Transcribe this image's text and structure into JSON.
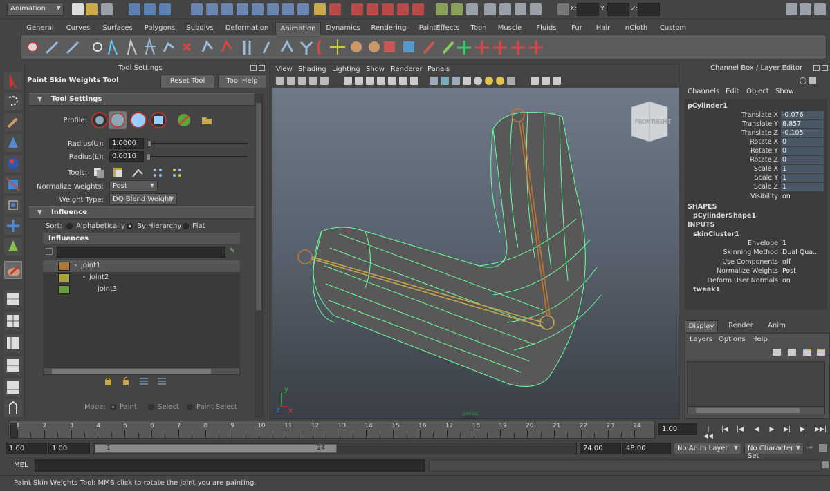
{
  "status_line": {
    "mode": "Animation",
    "x_label": "X:",
    "y_label": "Y:",
    "z_label": "Z:"
  },
  "shelf": {
    "tabs": [
      "General",
      "Curves",
      "Surfaces",
      "Polygons",
      "Subdivs",
      "Deformation",
      "Animation",
      "Dynamics",
      "Rendering",
      "PaintEffects",
      "Toon",
      "Muscle",
      "Fluids",
      "Fur",
      "Hair",
      "nCloth",
      "Custom"
    ],
    "active_tab": "Animation"
  },
  "tool_settings": {
    "panel_title": "Tool Settings",
    "tool_name": "Paint Skin Weights Tool",
    "reset_label": "Reset Tool",
    "help_label": "Tool Help",
    "section_tool_settings": "Tool Settings",
    "profile_label": "Profile:",
    "radius_u_label": "Radius(U):",
    "radius_u_value": "1.0000",
    "radius_l_label": "Radius(L):",
    "radius_l_value": "0.0010",
    "tools_label": "Tools:",
    "normalize_label": "Normalize Weights:",
    "normalize_value": "Post",
    "weight_type_label": "Weight Type:",
    "weight_type_value": "DQ Blend Weight",
    "section_influence": "Influence",
    "sort_label": "Sort:",
    "sort_options": [
      "Alphabetically",
      "By Hierarchy",
      "Flat"
    ],
    "influences_header": "Influences",
    "influences": [
      {
        "name": "joint1",
        "color": "#a8773a"
      },
      {
        "name": "joint2",
        "color": "#a8a23a"
      },
      {
        "name": "joint3",
        "color": "#6a9a3a"
      }
    ],
    "mode_label": "Mode:",
    "mode_options": [
      "Paint",
      "Select",
      "Paint Select"
    ]
  },
  "viewport": {
    "menus": [
      "View",
      "Shading",
      "Lighting",
      "Show",
      "Renderer",
      "Panels"
    ],
    "camera_label": "persp",
    "viewcube_left": "FRONT",
    "viewcube_right": "RIGHT"
  },
  "channel_box": {
    "title": "Channel Box / Layer Editor",
    "menus": [
      "Channels",
      "Edit",
      "Object",
      "Show"
    ],
    "object_name": "pCylinder1",
    "channels": [
      {
        "name": "Translate X",
        "value": "-0.076"
      },
      {
        "name": "Translate Y",
        "value": "8.857"
      },
      {
        "name": "Translate Z",
        "value": "-0.105"
      },
      {
        "name": "Rotate X",
        "value": "0"
      },
      {
        "name": "Rotate Y",
        "value": "0"
      },
      {
        "name": "Rotate Z",
        "value": "0"
      },
      {
        "name": "Scale X",
        "value": "1"
      },
      {
        "name": "Scale Y",
        "value": "1"
      },
      {
        "name": "Scale Z",
        "value": "1"
      },
      {
        "name": "Visibility",
        "value": "on"
      }
    ],
    "shapes_label": "SHAPES",
    "shape_name": "pCylinderShape1",
    "inputs_label": "INPUTS",
    "input_name": "skinCluster1",
    "input_attrs": [
      {
        "name": "Envelope",
        "value": "1"
      },
      {
        "name": "Skinning Method",
        "value": "Dual Qua..."
      },
      {
        "name": "Use Components",
        "value": "off"
      },
      {
        "name": "Normalize Weights",
        "value": "Post"
      },
      {
        "name": "Deform User Normals",
        "value": "on"
      }
    ],
    "tweak_name": "tweak1"
  },
  "layer_editor": {
    "tabs": [
      "Display",
      "Render",
      "Anim"
    ],
    "active_tab": "Display",
    "menus": [
      "Layers",
      "Options",
      "Help"
    ]
  },
  "time_slider": {
    "ticks": [
      "1",
      "2",
      "3",
      "4",
      "5",
      "6",
      "7",
      "8",
      "9",
      "10",
      "11",
      "12",
      "13",
      "14",
      "15",
      "16",
      "17",
      "18",
      "19",
      "20",
      "21",
      "22",
      "23",
      "24"
    ],
    "current_time": "1.00"
  },
  "range_slider": {
    "anim_start": "1.00",
    "range_start": "1.00",
    "range_handle_start": "1",
    "range_handle_end": "24",
    "range_end": "24.00",
    "anim_end": "48.00",
    "anim_layer": "No Anim Layer",
    "character_set": "No Character Set"
  },
  "command_line": {
    "label": "MEL"
  },
  "help_line": {
    "text": "Paint Skin Weights Tool: MMB click to rotate the joint you are painting."
  }
}
